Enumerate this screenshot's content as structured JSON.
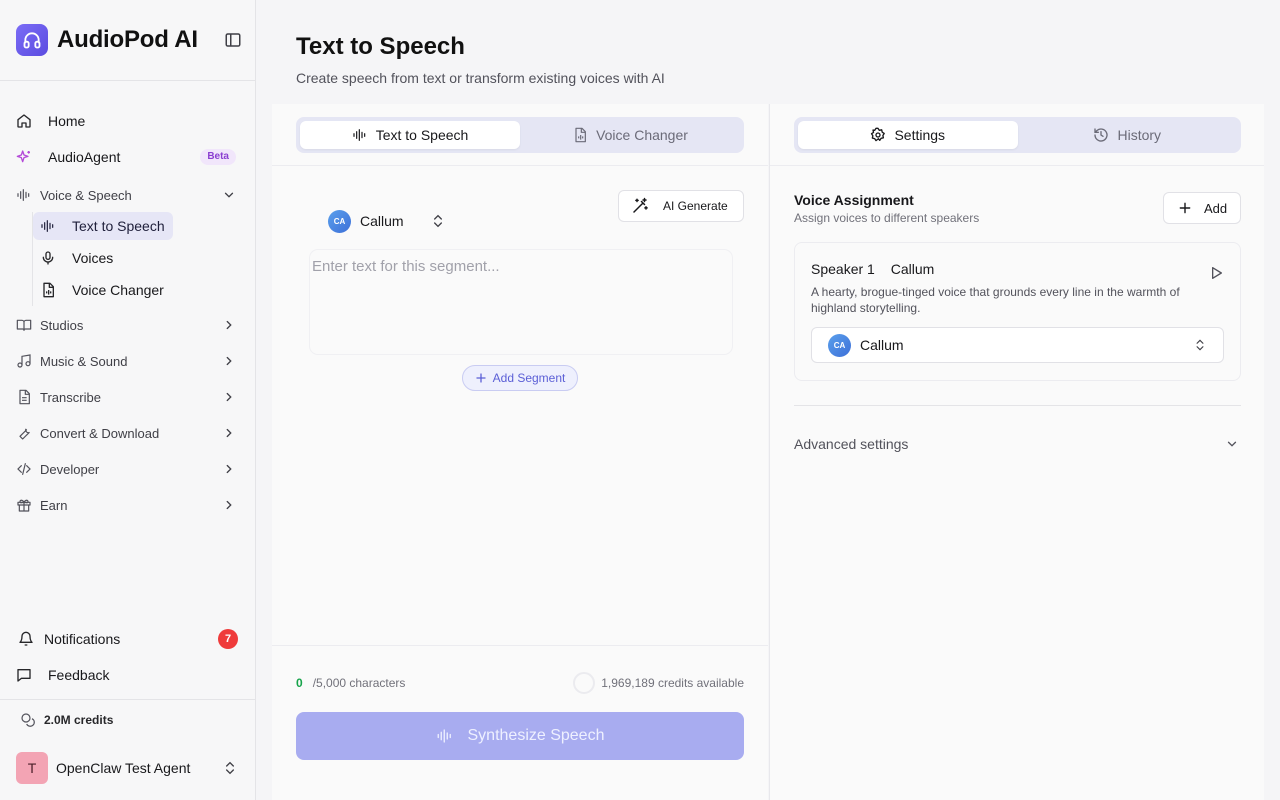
{
  "app": {
    "name": "AudioPod AI",
    "colors": {
      "accent": "#6366f1",
      "beta": "#8b3fd1",
      "notif": "#ef3b3b",
      "success": "#16a34a"
    }
  },
  "sidebar": {
    "top_items": [
      {
        "label": "Home",
        "icon": "home-icon"
      },
      {
        "label": "AudioAgent",
        "icon": "sparkles-icon",
        "badge": "Beta"
      }
    ],
    "voice_group": {
      "label": "Voice & Speech",
      "items": [
        {
          "label": "Text to Speech",
          "icon": "waveform-icon",
          "active": true
        },
        {
          "label": "Voices",
          "icon": "mic-icon"
        },
        {
          "label": "Voice Changer",
          "icon": "audio-file-icon"
        }
      ]
    },
    "groups": [
      {
        "label": "Studios",
        "icon": "book-icon"
      },
      {
        "label": "Music & Sound",
        "icon": "music-icon"
      },
      {
        "label": "Transcribe",
        "icon": "document-icon"
      },
      {
        "label": "Convert & Download",
        "icon": "wrench-icon"
      },
      {
        "label": "Developer",
        "icon": "code-icon"
      },
      {
        "label": "Earn",
        "icon": "gift-icon"
      }
    ],
    "bottom": {
      "notifications": {
        "label": "Notifications",
        "count": "7"
      },
      "feedback": {
        "label": "Feedback"
      },
      "credits": "2.0M credits",
      "user": {
        "initial": "T",
        "name": "OpenClaw Test Agent"
      }
    }
  },
  "page": {
    "title": "Text to Speech",
    "subtitle": "Create speech from text or transform existing voices with AI"
  },
  "editor": {
    "tabs": [
      {
        "label": "Text to Speech",
        "active": true
      },
      {
        "label": "Voice Changer",
        "active": false
      }
    ],
    "voice": {
      "initials": "CA",
      "name": "Callum"
    },
    "ai_generate": "AI Generate",
    "segment_placeholder": "Enter text for this segment...",
    "add_segment": "Add Segment",
    "char_count": "0",
    "char_limit": "/5,000 characters",
    "credits_available": "1,969,189 credits available",
    "synthesize": "Synthesize Speech"
  },
  "panel": {
    "tabs": [
      {
        "label": "Settings",
        "active": true
      },
      {
        "label": "History",
        "active": false
      }
    ],
    "voice_assignment": {
      "title": "Voice Assignment",
      "subtitle": "Assign voices to different speakers",
      "add": "Add"
    },
    "speaker": {
      "label": "Speaker 1",
      "voice_name": "Callum",
      "description": "A hearty, brogue-tinged voice that grounds every line in the warmth of highland storytelling.",
      "select_initials": "CA",
      "select_name": "Callum"
    },
    "advanced": "Advanced settings"
  }
}
